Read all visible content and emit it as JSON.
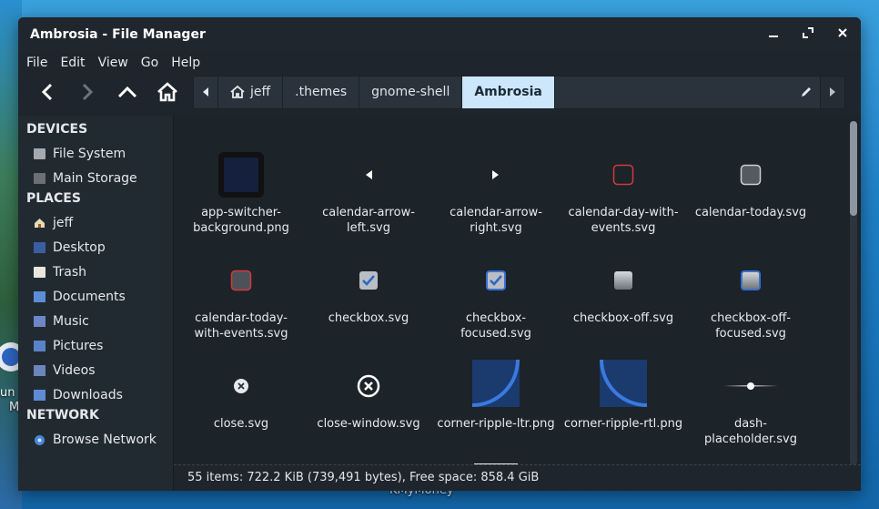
{
  "window": {
    "title": "Ambrosia - File Manager"
  },
  "menu": [
    "File",
    "Edit",
    "View",
    "Go",
    "Help"
  ],
  "path": {
    "crumbs": [
      "jeff",
      ".themes",
      "gnome-shell",
      "Ambrosia"
    ],
    "active_index": 3
  },
  "sidebar": {
    "devices_head": "DEVICES",
    "devices": [
      "File System",
      "Main Storage"
    ],
    "places_head": "PLACES",
    "places": [
      "jeff",
      "Desktop",
      "Trash",
      "Documents",
      "Music",
      "Pictures",
      "Videos",
      "Downloads"
    ],
    "network_head": "NETWORK",
    "network": [
      "Browse Network"
    ]
  },
  "files": [
    [
      "app-switcher-",
      "background.png"
    ],
    [
      "calendar-arrow-",
      "left.svg"
    ],
    [
      "calendar-arrow-",
      "right.svg"
    ],
    [
      "calendar-day-with-",
      "events.svg"
    ],
    [
      "calendar-today.svg"
    ],
    [
      "calendar-today-",
      "with-events.svg"
    ],
    [
      "checkbox.svg"
    ],
    [
      "checkbox-",
      "focused.svg"
    ],
    [
      "checkbox-off.svg"
    ],
    [
      "checkbox-off-",
      "focused.svg"
    ],
    [
      "close.svg"
    ],
    [
      "close-window.svg"
    ],
    [
      "corner-ripple-ltr.png"
    ],
    [
      "corner-ripple-rtl.png"
    ],
    [
      "dash-",
      "placeholder.svg"
    ]
  ],
  "status": {
    "text": "55 items: 722.2 KiB (739,491 bytes), Free space: 858.4 GiB"
  },
  "desktop": {
    "label_left_1": "un",
    "label_left_2": "M",
    "label_bottom": "KMyMoney"
  },
  "colors": {
    "accent_crumb": "#cce7fb",
    "window_bg": "#1e252c",
    "checkbox_blue": "#3a6fd0",
    "red_border": "#d23a3a"
  }
}
